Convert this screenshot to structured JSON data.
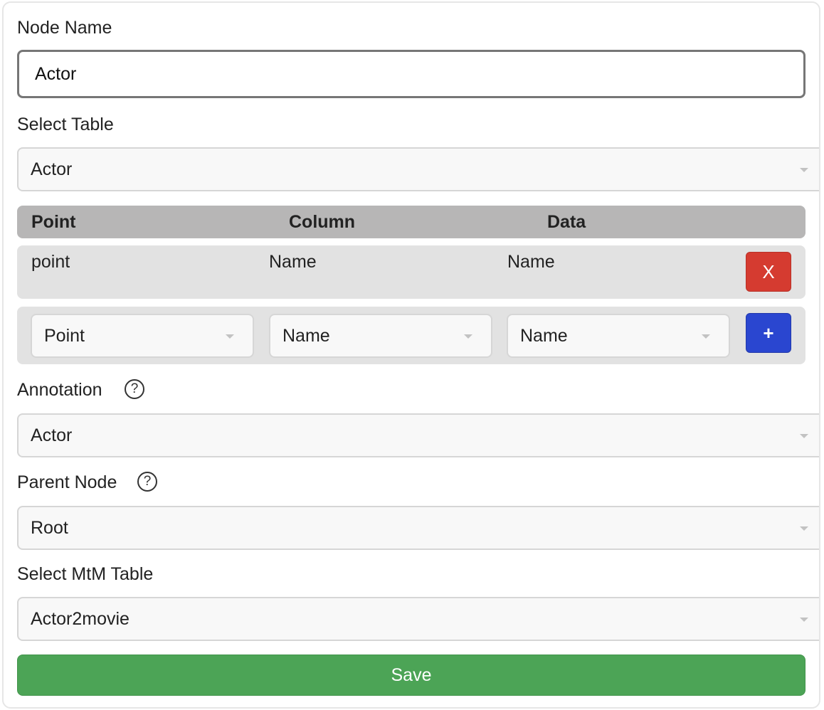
{
  "node_name": {
    "label": "Node Name",
    "value": "Actor"
  },
  "select_table": {
    "label": "Select Table",
    "value": "Actor"
  },
  "mapping_table": {
    "headers": [
      "Point",
      "Column",
      "Data"
    ],
    "rows": [
      {
        "point": "point",
        "column": "Name",
        "data": "Name",
        "delete_label": "X"
      }
    ],
    "new_row": {
      "point": "Point",
      "column": "Name",
      "data": "Name",
      "add_label": "+"
    }
  },
  "annotation": {
    "label": "Annotation",
    "help": "?",
    "value": "Actor"
  },
  "parent_node": {
    "label": "Parent Node",
    "help": "?",
    "value": "Root"
  },
  "mtm_table": {
    "label": "Select MtM Table",
    "value": "Actor2movie"
  },
  "save_label": "Save",
  "colors": {
    "delete": "#d53b30",
    "add": "#2a46d0",
    "save": "#4ca456",
    "header_bg": "#b7b6b6",
    "row_bg": "#e2e2e2"
  }
}
